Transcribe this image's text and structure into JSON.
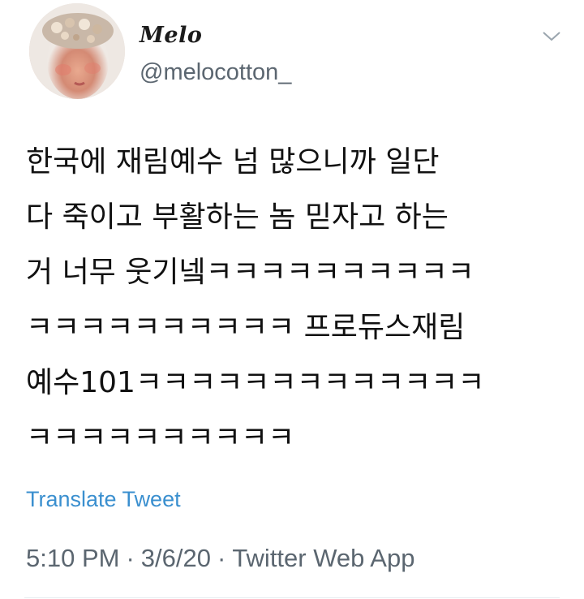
{
  "user": {
    "display_name": "Melo",
    "handle": "@melocotton_"
  },
  "icons": {
    "menu": "chevron-down-icon",
    "avatar": "profile-photo"
  },
  "tweet": {
    "lines": [
      "한국에 재림예수 넘 많으니까 일단",
      "다 죽이고 부활하는 놈 믿자고 하는",
      "거 너무 웃기넼ㅋㅋㅋㅋㅋㅋㅋㅋㅋㅋ",
      "ㅋㅋㅋㅋㅋㅋㅋㅋㅋㅋ 프로듀스재림",
      "예수101ㅋㅋㅋㅋㅋㅋㅋㅋㅋㅋㅋㅋㅋ",
      "ㅋㅋㅋㅋㅋㅋㅋㅋㅋㅋ"
    ],
    "translate_label": "Translate Tweet",
    "time": "5:10 PM",
    "date": "3/6/20",
    "separator": "·",
    "source": "Twitter Web App"
  },
  "colors": {
    "link": "#3a8fcf",
    "secondary_text": "#5b6670",
    "primary_text": "#111111"
  }
}
